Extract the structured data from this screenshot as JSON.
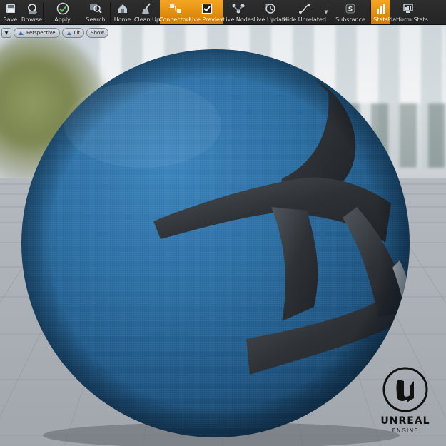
{
  "toolbar": {
    "buttons": [
      {
        "id": "save",
        "label": "Save",
        "icon": "save-icon",
        "active": false
      },
      {
        "id": "browse",
        "label": "Browse",
        "icon": "browse-icon",
        "active": false
      },
      {
        "id": "apply",
        "label": "Apply",
        "icon": "apply-icon",
        "active": false
      },
      {
        "id": "search",
        "label": "Search",
        "icon": "search-icon",
        "active": false
      },
      {
        "id": "home",
        "label": "Home",
        "icon": "home-icon",
        "active": false
      },
      {
        "id": "cleanup",
        "label": "Clean Up",
        "icon": "clean-up-icon",
        "active": false
      },
      {
        "id": "connectors",
        "label": "Connectors",
        "icon": "connectors-icon",
        "active": true
      },
      {
        "id": "livepreview",
        "label": "Live Preview",
        "icon": "live-preview-icon",
        "active": true
      },
      {
        "id": "livenodes",
        "label": "Live Nodes",
        "icon": "live-nodes-icon",
        "active": false
      },
      {
        "id": "liveupdate",
        "label": "Live Update",
        "icon": "live-update-icon",
        "active": false
      },
      {
        "id": "hideunrelated",
        "label": "Hide Unrelated",
        "icon": "hide-unrelated-icon",
        "active": false
      },
      {
        "id": "substance",
        "label": "Substance",
        "icon": "substance-icon",
        "active": false
      },
      {
        "id": "stats",
        "label": "Stats",
        "icon": "stats-icon",
        "active": true
      },
      {
        "id": "platformstats",
        "label": "Platform Stats",
        "icon": "platform-stats-icon",
        "active": false
      }
    ]
  },
  "viewport": {
    "perspective_label": "Perspective",
    "lit_label": "Lit",
    "show_label": "Show"
  },
  "logo": {
    "name": "UNREAL",
    "sub": "ENGINE"
  },
  "colors": {
    "accent": "#f5a623",
    "toolbar_bg": "#262626",
    "sphere_blue": "#2c6fa3",
    "strap_dark": "#2f3338"
  }
}
